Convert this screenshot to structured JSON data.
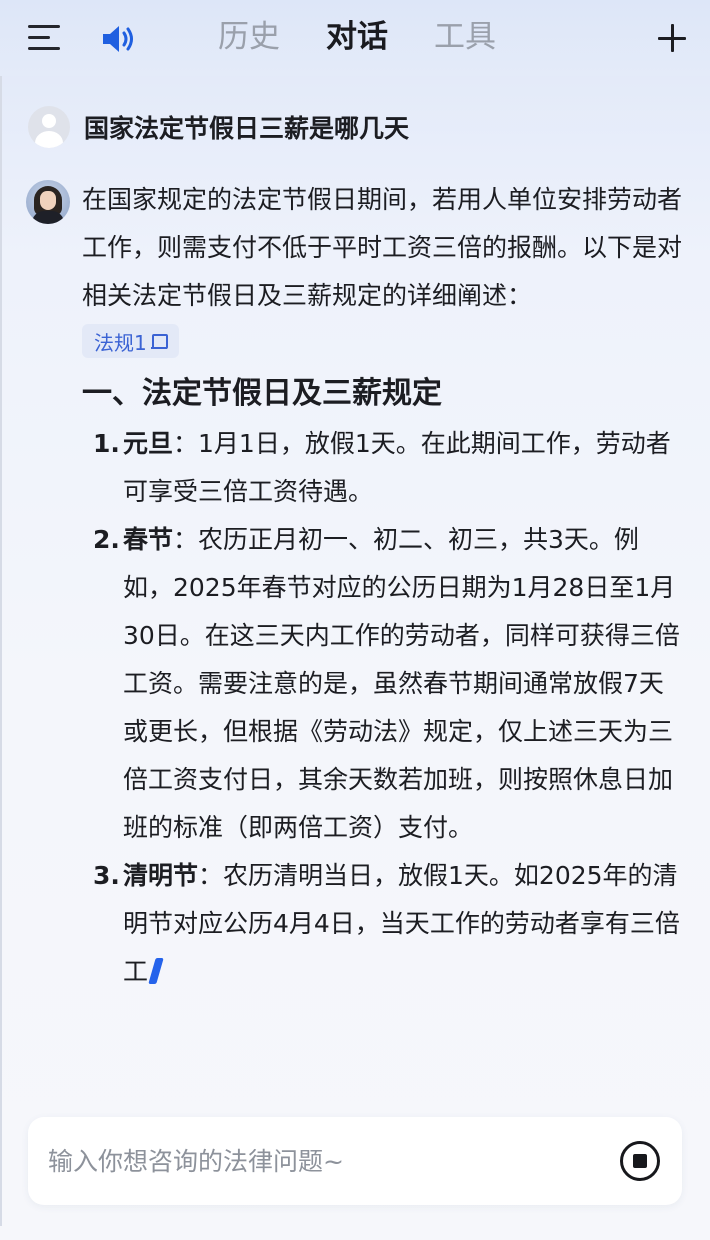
{
  "header": {
    "tabs": [
      {
        "label": "历史"
      },
      {
        "label": "对话"
      },
      {
        "label": "工具"
      }
    ],
    "active_tab": "对话",
    "icons": {
      "menu": "menu-icon",
      "speaker": "speaker-icon",
      "new_chat": "plus-icon"
    }
  },
  "conversation": {
    "user_question": "国家法定节假日三薪是哪几天",
    "answer": {
      "intro": "在国家规定的法定节假日期间，若用人单位安排劳动者工作，则需支付不低于平时工资三倍的报酬。以下是对相关法定节假日及三薪规定的详细阐述：",
      "reference_chip": "法规1",
      "section_title": "一、法定节假日及三薪规定",
      "items": [
        {
          "num": "1.",
          "term": "元旦",
          "text": "：1月1日，放假1天。在此期间工作，劳动者可享受三倍工资待遇。"
        },
        {
          "num": "2.",
          "term": "春节",
          "text": "：农历正月初一、初二、初三，共3天。例如，2025年春节对应的公历日期为1月28日至1月30日。在这三天内工作的劳动者，同样可获得三倍工资。需要注意的是，虽然春节期间通常放假7天或更长，但根据《劳动法》规定，仅上述三天为三倍工资支付日，其余天数若加班，则按照休息日加班的标准（即两倍工资）支付。"
        },
        {
          "num": "3.",
          "term": "清明节",
          "text": "：农历清明当日，放假1天。如2025年的清明节对应公历4月4日，当天工作的劳动者享有三倍工"
        }
      ]
    }
  },
  "input": {
    "placeholder": "输入你想咨询的法律问题~",
    "value": ""
  },
  "colors": {
    "accent": "#2563eb",
    "chip_bg": "#e3e9f7",
    "chip_text": "#3b63d4"
  }
}
